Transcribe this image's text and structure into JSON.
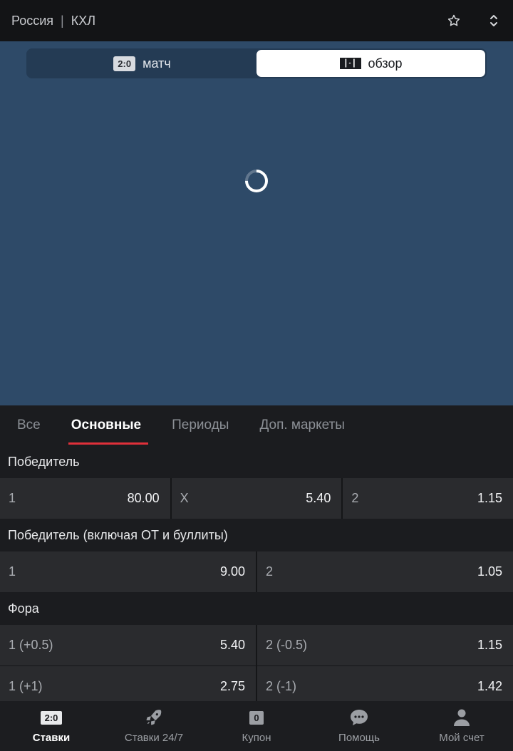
{
  "header": {
    "breadcrumb": [
      "Россия",
      "КХЛ"
    ],
    "separator": "|",
    "icons": [
      "star-icon",
      "expand-collapse-icon"
    ]
  },
  "switcher": {
    "match": {
      "chip": "2:0",
      "label": "матч"
    },
    "overview": {
      "chip": "┃◦┃",
      "label": "обзор",
      "active": true
    }
  },
  "tabs": [
    {
      "label": "Все"
    },
    {
      "label": "Основные",
      "active": true
    },
    {
      "label": "Периоды"
    },
    {
      "label": "Доп. маркеты"
    }
  ],
  "markets": {
    "winner": {
      "title": "Победитель",
      "odds": [
        {
          "label": "1",
          "value": "80.00"
        },
        {
          "label": "X",
          "value": "5.40"
        },
        {
          "label": "2",
          "value": "1.15"
        }
      ]
    },
    "winner_ot": {
      "title": "Победитель (включая ОТ и буллиты)",
      "odds": [
        {
          "label": "1",
          "value": "9.00"
        },
        {
          "label": "2",
          "value": "1.05"
        }
      ]
    },
    "handicap": {
      "title": "Фора",
      "rows": [
        [
          {
            "label": "1 (+0.5)",
            "value": "5.40"
          },
          {
            "label": "2 (-0.5)",
            "value": "1.15"
          }
        ],
        [
          {
            "label": "1 (+1)",
            "value": "2.75"
          },
          {
            "label": "2 (-1)",
            "value": "1.42"
          }
        ]
      ]
    }
  },
  "bottom_nav": [
    {
      "icon_text": "2:0",
      "label": "Ставки",
      "active": true
    },
    {
      "icon": "rocket-icon",
      "label": "Ставки 24/7"
    },
    {
      "icon_text": "0",
      "label": "Купон"
    },
    {
      "icon": "chat-bubble-icon",
      "label": "Помощь"
    },
    {
      "icon": "person-icon",
      "label": "Мой счет"
    }
  ],
  "colors": {
    "accent": "#e0303a",
    "stage_bg": "#2e4a68",
    "surface": "#2a2b2e"
  }
}
